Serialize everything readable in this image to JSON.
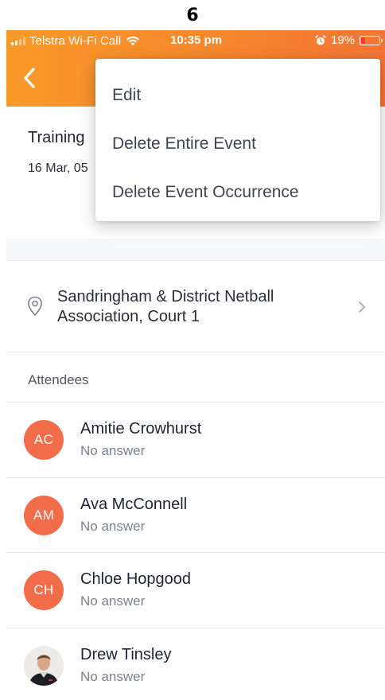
{
  "page_number": "6",
  "status_bar": {
    "carrier": "Telstra Wi-Fi Call",
    "time": "10:35 pm",
    "battery": "19%",
    "battery_level": 0.19,
    "battery_color": "#ff3b30"
  },
  "header": {
    "back_icon": "chevron-left-icon",
    "gradient": [
      "#f89a2a",
      "#f47436"
    ]
  },
  "event": {
    "title": "Training",
    "date": "16 Mar, 05"
  },
  "location": {
    "icon": "map-pin-icon",
    "line1": "Sandringham & District Netball",
    "line2": "Association, Court 1"
  },
  "attendees_section": {
    "label": "Attendees"
  },
  "attendees": [
    {
      "initials": "AC",
      "name": "Amitie Crowhurst",
      "status": "No answer"
    },
    {
      "initials": "AM",
      "name": "Ava McConnell",
      "status": "No answer"
    },
    {
      "initials": "CH",
      "name": "Chloe Hopgood",
      "status": "No answer"
    },
    {
      "initials": "",
      "name": "Drew Tinsley",
      "status": "No answer"
    }
  ],
  "avatar_color": "#f46d4a",
  "menu": {
    "items": [
      {
        "label": "Edit"
      },
      {
        "label": "Delete Entire Event"
      },
      {
        "label": "Delete Event Occurrence"
      }
    ]
  }
}
